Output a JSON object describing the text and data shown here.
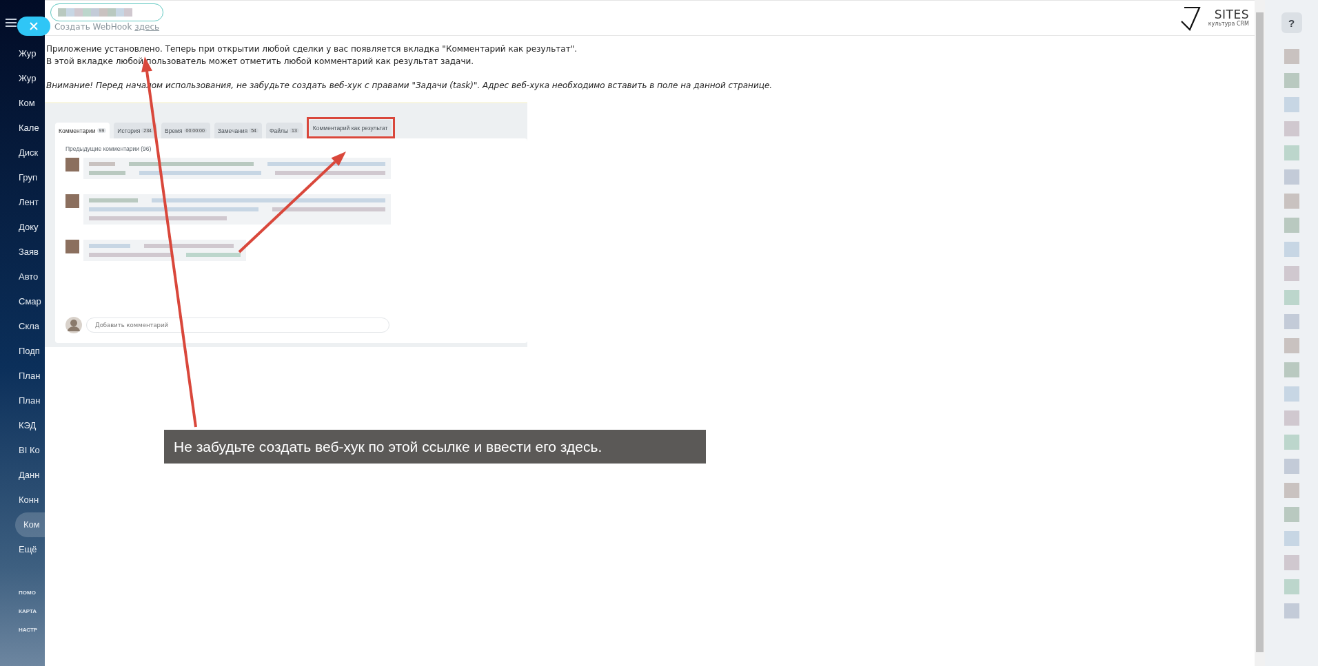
{
  "sidebar": {
    "items": [
      {
        "label": "Жур",
        "selected": false
      },
      {
        "label": "Жур",
        "selected": false
      },
      {
        "label": "Ком",
        "selected": false
      },
      {
        "label": "Кале",
        "selected": false
      },
      {
        "label": "Диск",
        "selected": false
      },
      {
        "label": "Груп",
        "selected": false
      },
      {
        "label": "Лент",
        "selected": false
      },
      {
        "label": "Доку",
        "selected": false
      },
      {
        "label": "Заяв",
        "selected": false
      },
      {
        "label": "Авто",
        "selected": false
      },
      {
        "label": "Смар",
        "selected": false
      },
      {
        "label": "Скла",
        "selected": false
      },
      {
        "label": "Подп",
        "selected": false
      },
      {
        "label": "План",
        "selected": false
      },
      {
        "label": "План",
        "selected": false
      },
      {
        "label": "КЭД",
        "selected": false
      },
      {
        "label": "BI Ко",
        "selected": false
      },
      {
        "label": "Данн",
        "selected": false
      },
      {
        "label": "Конн",
        "selected": false
      },
      {
        "label": "Ком",
        "selected": true
      },
      {
        "label": "Ещё",
        "selected": false
      }
    ],
    "footer_links": [
      "ПОМО",
      "КАРТА",
      "НАСТР"
    ]
  },
  "webhook_hint": {
    "text": "Создать WebHook",
    "link": "здесь"
  },
  "paragraphs": [
    {
      "kind": "plain",
      "text": "Приложение установлено. Теперь при открытии любой сделки у вас появляется вкладка \"Комментарий как результат\"."
    },
    {
      "kind": "plain",
      "text": "В этой вкладке любой пользователь может отметить любой комментарий как результат задачи."
    },
    {
      "kind": "note",
      "text": "Внимание! Перед началом использования, не забудьте создать веб-хук с правами \"Задачи (task)\". Адрес веб-хука необходимо вставить в поле на данной странице."
    }
  ],
  "embedded_screenshot": {
    "tabs": [
      {
        "label": "Комментарии",
        "count": "99",
        "selected": true,
        "highlighted": false
      },
      {
        "label": "История",
        "count": "234",
        "selected": false,
        "highlighted": false
      },
      {
        "label": "Время",
        "count": "00:00:00",
        "selected": false,
        "highlighted": false
      },
      {
        "label": "Замечания",
        "count": "54",
        "selected": false,
        "highlighted": false
      },
      {
        "label": "Файлы",
        "count": "13",
        "selected": false,
        "highlighted": false
      },
      {
        "label": "Комментарий как результат",
        "selected": false,
        "highlighted": true
      }
    ],
    "previous_comments": "Предыдущие комментарии (96)",
    "comment_placeholder": "Добавить комментарий"
  },
  "callout": {
    "text": "Не забудьте создать веб-хук по этой ссылке и ввести его здесь."
  },
  "logo": {
    "name": "SITES",
    "tagline": "культура CRM"
  },
  "help_button": {
    "label": "?"
  }
}
